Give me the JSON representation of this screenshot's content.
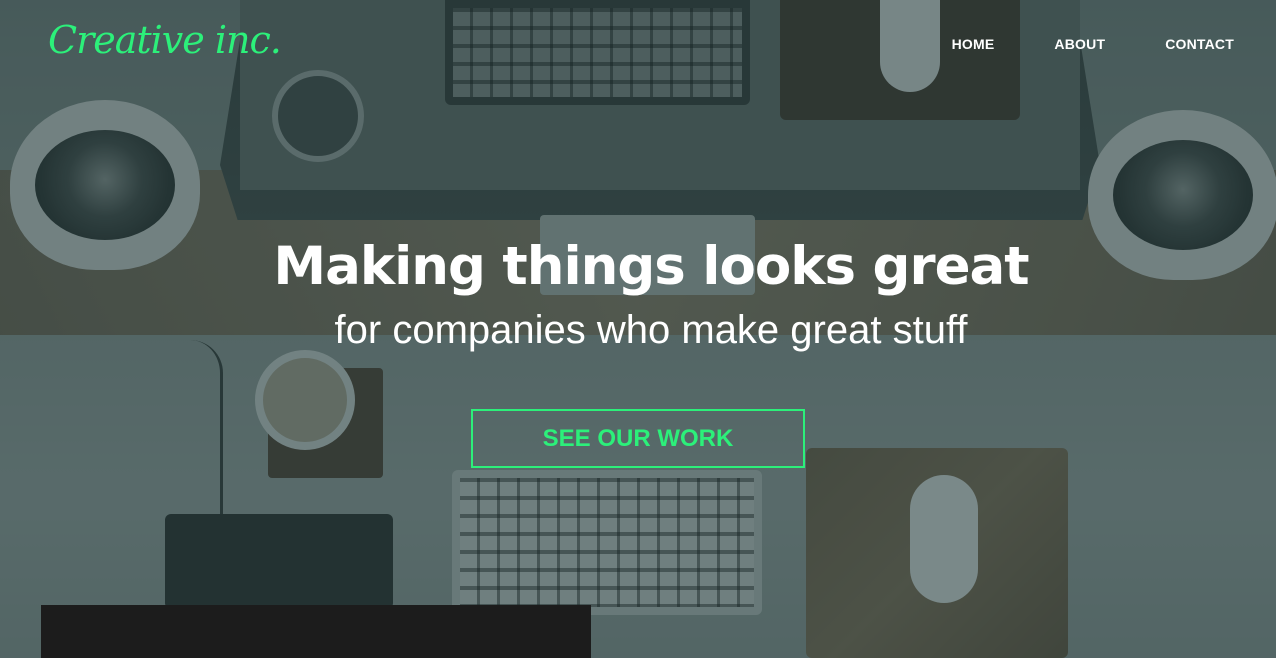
{
  "brand": {
    "logo_text": "Creative inc.",
    "accent_color": "#2cf07a"
  },
  "nav": {
    "items": [
      {
        "label": "HOME"
      },
      {
        "label": "ABOUT"
      },
      {
        "label": "CONTACT"
      }
    ]
  },
  "hero": {
    "headline": "Making things looks great",
    "subheadline": "for companies who make great stuff",
    "cta_label": "SEE OUR WORK",
    "background_image": "desk-workspace-photo"
  }
}
